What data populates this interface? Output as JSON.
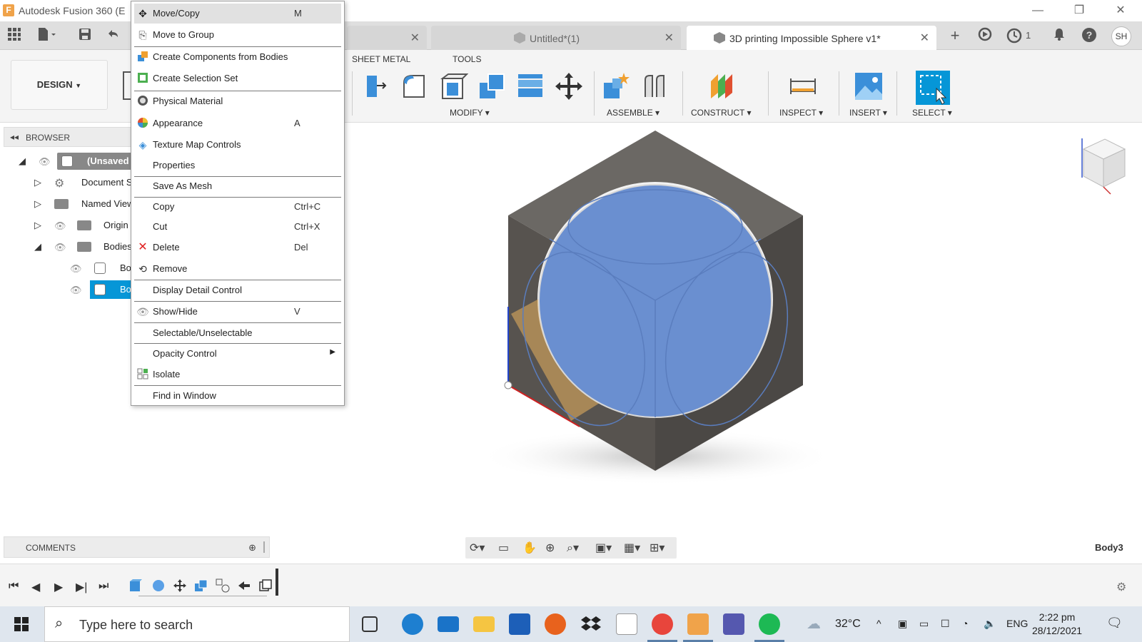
{
  "window": {
    "title": "Autodesk Fusion 360 (E",
    "app_logo": "F",
    "minimize": "—",
    "restore": "❐",
    "close": "✕"
  },
  "tabs": [
    {
      "label": "",
      "active": false
    },
    {
      "label": "Untitled*(1)",
      "active": false
    },
    {
      "label": "3D printing Impossible Sphere v1*",
      "active": true
    }
  ],
  "tabbar": {
    "job_count": "1",
    "user_initials": "SH"
  },
  "toolbar": {
    "workspace": "DESIGN",
    "ws_tabs": [
      "SHEET METAL",
      "TOOLS"
    ],
    "groups": [
      "MODIFY",
      "ASSEMBLE",
      "CONSTRUCT",
      "INSPECT",
      "INSERT",
      "SELECT"
    ]
  },
  "browser": {
    "header": "BROWSER",
    "rows": [
      {
        "label": "(Unsaved",
        "level": 0
      },
      {
        "label": "Document S",
        "level": 1
      },
      {
        "label": "Named View",
        "level": 1
      },
      {
        "label": "Origin",
        "level": 1
      },
      {
        "label": "Bodies",
        "level": 1
      },
      {
        "label": "Bo",
        "level": 2
      },
      {
        "label": "Bo",
        "level": 2,
        "selected": true
      }
    ]
  },
  "context_menu": {
    "items": [
      {
        "label": "Move/Copy",
        "shortcut": "M",
        "icon": "move-icon"
      },
      {
        "label": "Move to Group",
        "shortcut": "",
        "icon": "group-icon"
      },
      {
        "label": "Create Components from Bodies",
        "shortcut": "",
        "icon": "components-icon"
      },
      {
        "label": "Create Selection Set",
        "shortcut": "",
        "icon": "selection-set-icon"
      },
      {
        "label": "Physical Material",
        "shortcut": "",
        "icon": "material-icon"
      },
      {
        "label": "Appearance",
        "shortcut": "A",
        "icon": "appearance-icon"
      },
      {
        "label": "Texture Map Controls",
        "shortcut": "",
        "icon": "texture-icon"
      },
      {
        "label": "Properties",
        "shortcut": "",
        "icon": ""
      },
      {
        "label": "Save As Mesh",
        "shortcut": "",
        "icon": ""
      },
      {
        "label": "Copy",
        "shortcut": "Ctrl+C",
        "icon": ""
      },
      {
        "label": "Cut",
        "shortcut": "Ctrl+X",
        "icon": ""
      },
      {
        "label": "Delete",
        "shortcut": "Del",
        "icon": "delete-icon"
      },
      {
        "label": "Remove",
        "shortcut": "",
        "icon": "remove-icon"
      },
      {
        "label": "Display Detail Control",
        "shortcut": "",
        "icon": ""
      },
      {
        "label": "Show/Hide",
        "shortcut": "V",
        "icon": "eye-icon"
      },
      {
        "label": "Selectable/Unselectable",
        "shortcut": "",
        "icon": ""
      },
      {
        "label": "Opacity Control",
        "shortcut": "",
        "icon": ""
      },
      {
        "label": "Isolate",
        "shortcut": "",
        "icon": "isolate-icon"
      },
      {
        "label": "Find in Window",
        "shortcut": "",
        "icon": ""
      }
    ]
  },
  "viewport": {
    "comments": "COMMENTS",
    "selection": "Body3"
  },
  "taskbar": {
    "search_placeholder": "Type here to search",
    "temperature": "32°C",
    "language": "ENG",
    "time": "2:22 pm",
    "date": "28/12/2021"
  },
  "colors": {
    "accent": "#0696d7",
    "sphere": "#6a8fd0",
    "cube": "#5a5652"
  }
}
